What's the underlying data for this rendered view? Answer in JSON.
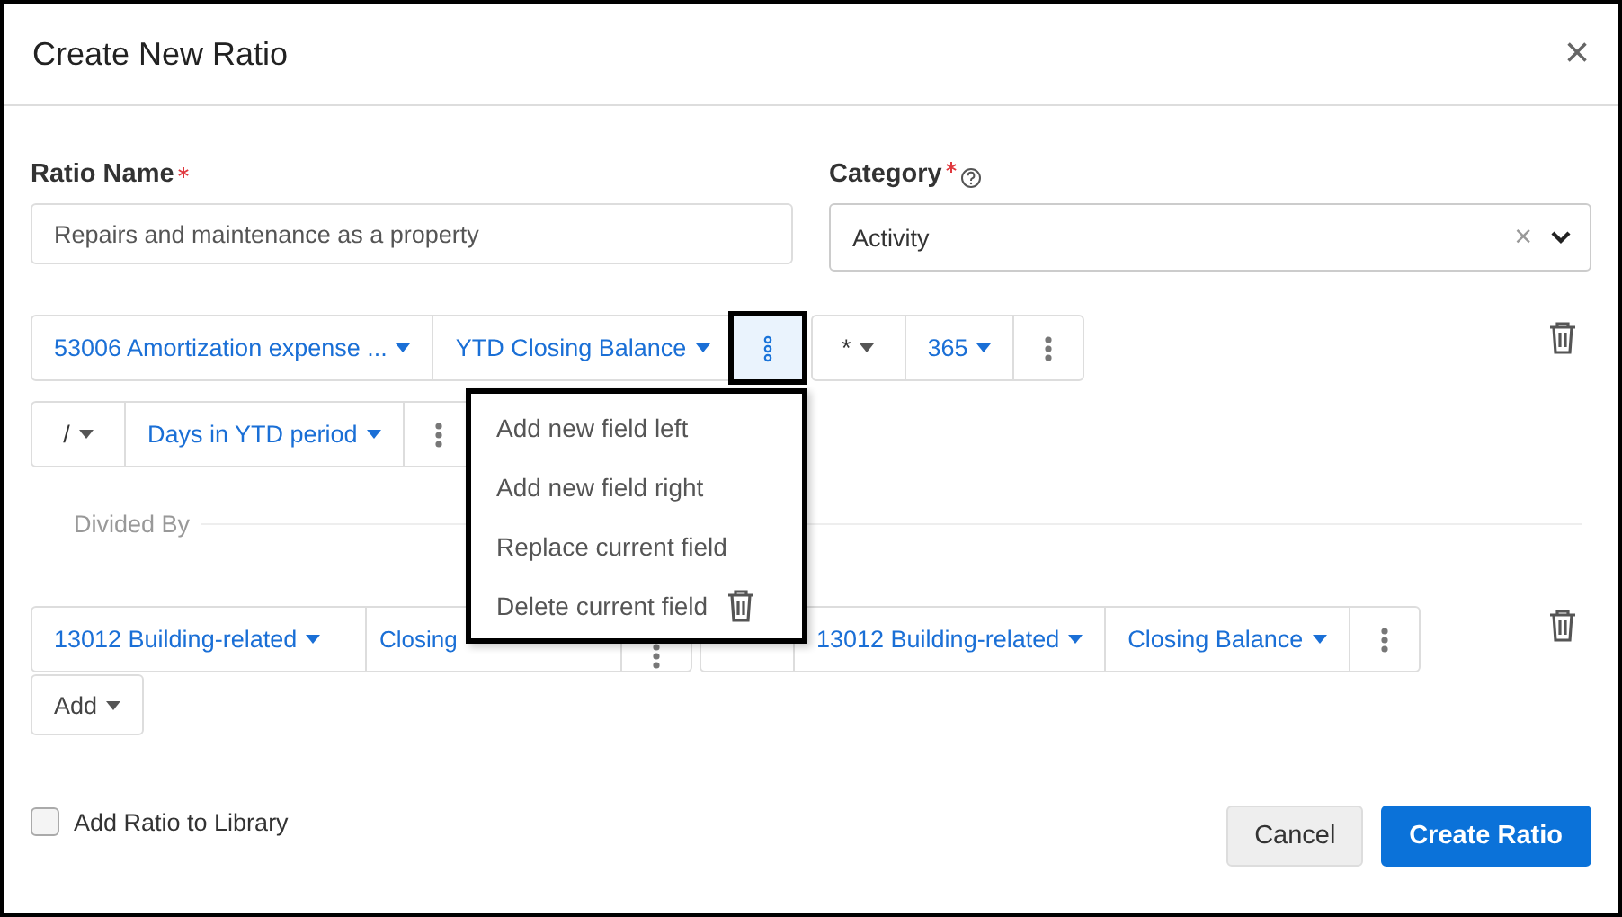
{
  "window": {
    "title": "Create New Ratio",
    "close": "×"
  },
  "ratio_name": {
    "label": "Ratio Name",
    "required": true,
    "value": "Repairs and maintenance as a property"
  },
  "category": {
    "label": "Category",
    "required": true,
    "value": "Activity",
    "clear": "×"
  },
  "numerator_rows": [
    {
      "groups": [
        {
          "segments": [
            {
              "kind": "field",
              "text": "53006 Amortization expense ..."
            },
            {
              "kind": "field",
              "text": "YTD Closing Balance"
            },
            {
              "kind": "menu",
              "active": true
            }
          ]
        },
        {
          "segments": [
            {
              "kind": "operator",
              "text": "*"
            },
            {
              "kind": "field",
              "text": "365"
            },
            {
              "kind": "menu",
              "active": false
            }
          ]
        }
      ],
      "deletable": true
    },
    {
      "groups": [
        {
          "segments": [
            {
              "kind": "operator",
              "text": "/"
            },
            {
              "kind": "field",
              "text": "Days in YTD period"
            },
            {
              "kind": "menu",
              "active": false
            }
          ]
        }
      ],
      "deletable": false
    }
  ],
  "divider": "Divided By",
  "denominator_rows": [
    {
      "groups": [
        {
          "segments": [
            {
              "kind": "field",
              "text": "13012 Building-related"
            },
            {
              "kind": "field",
              "text": "Closing"
            },
            {
              "kind": "menu",
              "active": false
            }
          ]
        },
        {
          "segments": [
            {
              "kind": "operator"
            },
            {
              "kind": "field",
              "text": "13012 Building-related"
            },
            {
              "kind": "field",
              "text": "Closing Balance"
            },
            {
              "kind": "menu",
              "active": false
            }
          ]
        }
      ],
      "deletable": true
    }
  ],
  "add_button": "Add",
  "context_menu": [
    {
      "kind": "plain",
      "label": "Add new field left"
    },
    {
      "kind": "plain",
      "label": "Add new field right"
    },
    {
      "kind": "plain",
      "label": "Replace current field"
    },
    {
      "kind": "delete",
      "label": "Delete current field"
    }
  ],
  "library_checkbox": {
    "label": "Add Ratio to Library",
    "checked": false
  },
  "buttons": [
    {
      "kind": "secondary",
      "label": "Cancel"
    },
    {
      "kind": "primary",
      "label": "Create Ratio"
    }
  ]
}
